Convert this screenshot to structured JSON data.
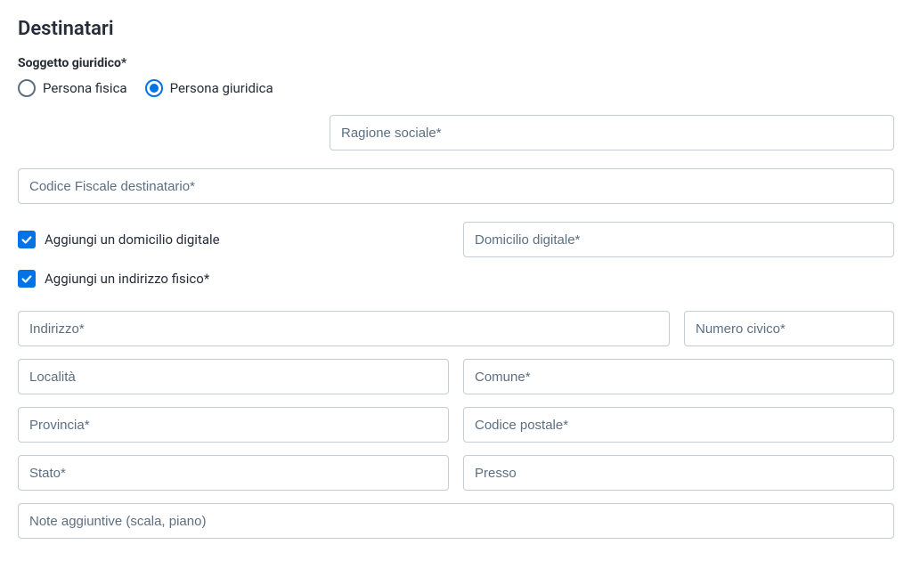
{
  "title": "Destinatari",
  "soggetto": {
    "label": "Soggetto giuridico*",
    "options": {
      "fisica": "Persona fisica",
      "giuridica": "Persona giuridica"
    }
  },
  "fields": {
    "ragione_sociale": "Ragione sociale*",
    "codice_fiscale": "Codice Fiscale destinatario*",
    "domicilio_digitale": "Domicilio digitale*",
    "indirizzo": "Indirizzo*",
    "numero_civico": "Numero civico*",
    "localita": "Località",
    "comune": "Comune*",
    "provincia": "Provincia*",
    "codice_postale": "Codice postale*",
    "stato": "Stato*",
    "presso": "Presso",
    "note": "Note aggiuntive (scala, piano)"
  },
  "checkboxes": {
    "domicilio_digitale": "Aggiungi un domicilio digitale",
    "indirizzo_fisico": "Aggiungi un indirizzo fisico*"
  }
}
